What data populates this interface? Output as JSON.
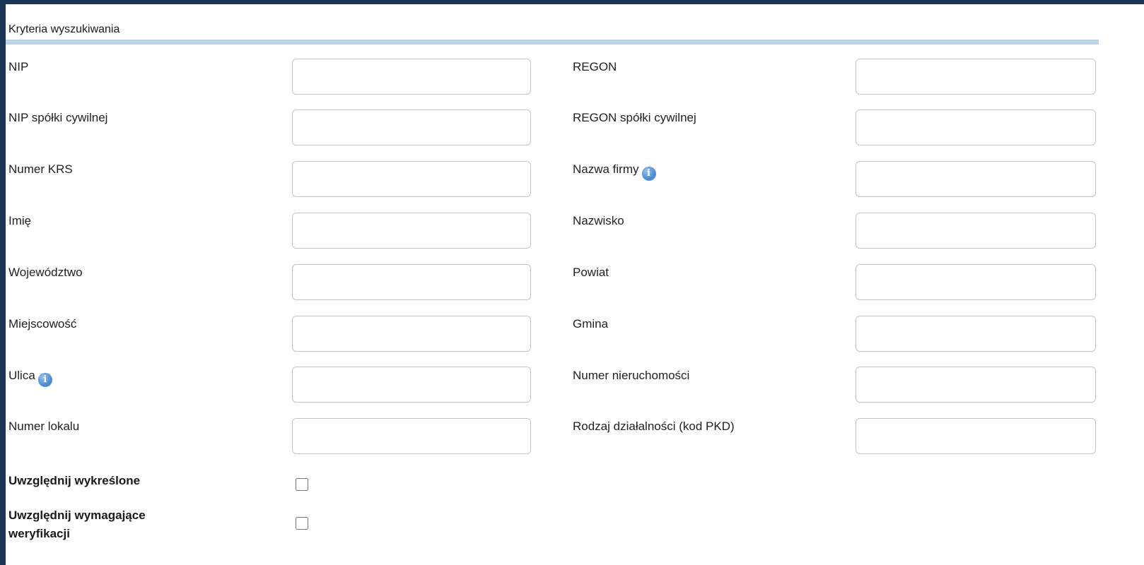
{
  "section": {
    "title": "Kryteria wyszukiwania"
  },
  "left_fields": [
    {
      "label": "NIP",
      "value": ""
    },
    {
      "label": "NIP spółki cywilnej",
      "value": ""
    },
    {
      "label": "Numer KRS",
      "value": ""
    },
    {
      "label": "Imię",
      "value": ""
    },
    {
      "label": "Województwo",
      "value": ""
    },
    {
      "label": "Miejscowość",
      "value": ""
    },
    {
      "label": "Ulica",
      "value": "",
      "info_icon": "info-icon"
    },
    {
      "label": "Numer lokalu",
      "value": ""
    }
  ],
  "right_fields": [
    {
      "label": "REGON",
      "value": ""
    },
    {
      "label": "REGON spółki cywilnej",
      "value": ""
    },
    {
      "label": "Nazwa firmy",
      "value": "",
      "info_icon": "info-icon"
    },
    {
      "label": "Nazwisko",
      "value": ""
    },
    {
      "label": "Powiat",
      "value": ""
    },
    {
      "label": "Gmina",
      "value": ""
    },
    {
      "label": "Numer nieruchomości",
      "value": ""
    },
    {
      "label": "Rodzaj działalności (kod PKD)",
      "value": ""
    }
  ],
  "options": [
    {
      "label": "Uwzględnij wykreślone",
      "checked": false
    },
    {
      "label": "Uwzględnij wymagające weryfikacji",
      "checked": false
    }
  ],
  "icons": {
    "info_glyph": "i"
  },
  "colors": {
    "frame": "#1b3554",
    "header_rule": "#bcd3e8",
    "info_icon": "#4f8fd6",
    "field_border": "#c4c4c4"
  }
}
